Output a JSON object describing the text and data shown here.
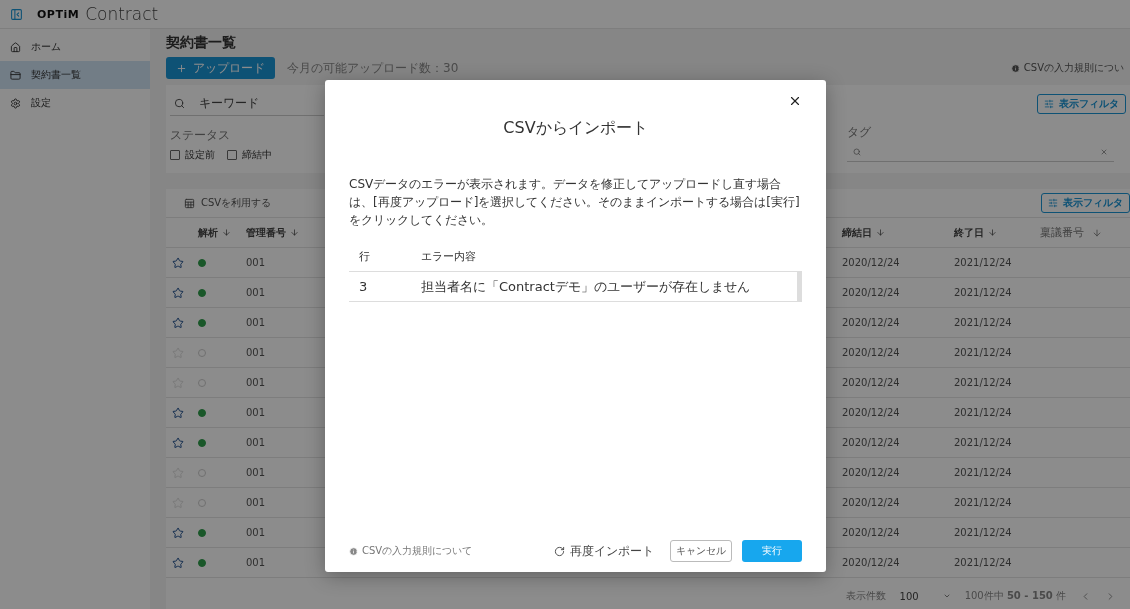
{
  "header": {
    "logo": "OPTiM",
    "title": "Contract"
  },
  "sidebar": {
    "items": [
      {
        "label": "ホーム",
        "selected": false
      },
      {
        "label": "契約書一覧",
        "selected": true
      },
      {
        "label": "設定",
        "selected": false
      }
    ]
  },
  "page": {
    "title": "契約書一覧",
    "upload_button": "アップロード",
    "upload_quota": "今月の可能アップロード数：30",
    "csv_rules_link": "CSVの入力規則につい"
  },
  "filters": {
    "keyword_placeholder": "キーワード",
    "status_label": "ステータス",
    "statuses": [
      {
        "label": "設定前",
        "checked": false
      },
      {
        "label": "締結中",
        "checked": false
      }
    ],
    "tag_label": "タグ",
    "display_filter_button": "表示フィルタ"
  },
  "table": {
    "csv_button": "CSVを利用する",
    "display_filter_button": "表示フィルタ",
    "columns": [
      "解析",
      "管理番号",
      "締結日",
      "終了日",
      "稟議番号"
    ],
    "rows": [
      {
        "starred": true,
        "analyzed": true,
        "number": "001",
        "signed": "2020/12/24",
        "end": "2021/12/24"
      },
      {
        "starred": true,
        "analyzed": true,
        "number": "001",
        "signed": "2020/12/24",
        "end": "2021/12/24"
      },
      {
        "starred": true,
        "analyzed": true,
        "number": "001",
        "signed": "2020/12/24",
        "end": "2021/12/24"
      },
      {
        "starred": false,
        "analyzed": false,
        "number": "001",
        "signed": "2020/12/24",
        "end": "2021/12/24"
      },
      {
        "starred": false,
        "analyzed": false,
        "number": "001",
        "signed": "2020/12/24",
        "end": "2021/12/24"
      },
      {
        "starred": true,
        "analyzed": true,
        "number": "001",
        "signed": "2020/12/24",
        "end": "2021/12/24"
      },
      {
        "starred": true,
        "analyzed": true,
        "number": "001",
        "signed": "2020/12/24",
        "end": "2021/12/24"
      },
      {
        "starred": false,
        "analyzed": false,
        "number": "001",
        "signed": "2020/12/24",
        "end": "2021/12/24"
      },
      {
        "starred": false,
        "analyzed": false,
        "number": "001",
        "signed": "2020/12/24",
        "end": "2021/12/24"
      },
      {
        "starred": true,
        "analyzed": true,
        "number": "001",
        "signed": "2020/12/24",
        "end": "2021/12/24"
      },
      {
        "starred": true,
        "analyzed": true,
        "number": "001",
        "signed": "2020/12/24",
        "end": "2021/12/24"
      }
    ]
  },
  "pagination": {
    "per_page_label": "表示件数",
    "per_page": "100",
    "range": "100件中 **50 - 150** 件"
  },
  "dialog": {
    "title": "CSVからインポート",
    "message": "CSVデータのエラーが表示されます。データを修正してアップロードし直す場合は、[再度アップロード]を選択してください。そのままインポートする場合は[実行]をクリックしてください。",
    "columns": [
      "行",
      "エラー内容"
    ],
    "errors": [
      {
        "row": "3",
        "message": "担当者名に「Contractデモ」のユーザーが存在しません"
      }
    ],
    "rules_link": "CSVの入力規則について",
    "reimport_button": "再度インポート",
    "cancel_button": "キャンセル",
    "execute_button": "実行"
  }
}
